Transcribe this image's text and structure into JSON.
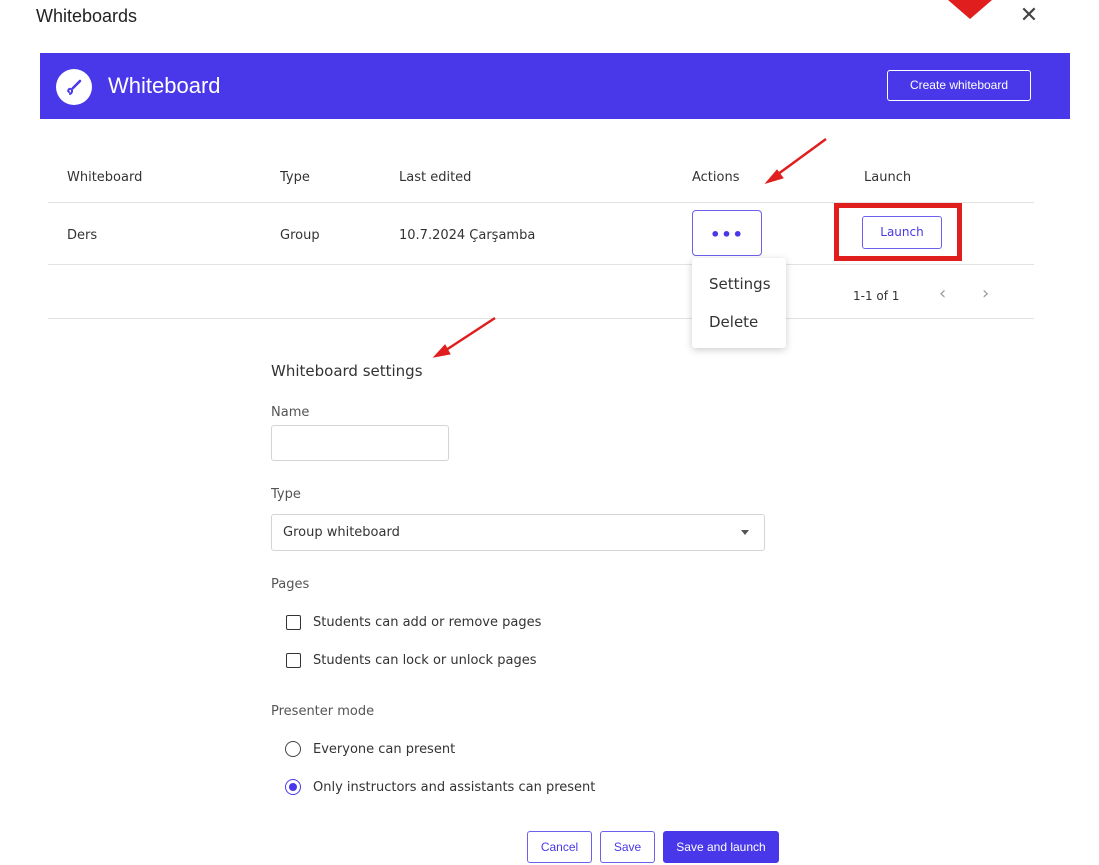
{
  "dialog": {
    "title": "Whiteboards",
    "close_glyph": "✕",
    "close_icon": "close-icon"
  },
  "banner": {
    "background_color": "#4938e9",
    "logo_icon": "whiteboard-brush-icon",
    "title": "Whiteboard",
    "create_button": "Create whiteboard"
  },
  "table": {
    "headers": [
      "Whiteboard",
      "Type",
      "Last edited",
      "Actions",
      "Launch"
    ],
    "rows": [
      {
        "name": "Ders",
        "type": "Group",
        "last_edited": "10.7.2024 Çarşamba",
        "actions_glyph": "•••",
        "launch": "Launch"
      }
    ]
  },
  "actions_menu": {
    "items": [
      "Settings",
      "Delete"
    ]
  },
  "pagination": {
    "text": "1-1 of 1",
    "prev_glyph": "‹",
    "next_glyph": "›"
  },
  "settings": {
    "title": "Whiteboard settings",
    "name_label": "Name",
    "name_value": "",
    "type_label": "Type",
    "type_value": "Group whiteboard",
    "pages_label": "Pages",
    "pages_options": [
      {
        "label": "Students can add or remove pages",
        "checked": false
      },
      {
        "label": "Students can lock or unlock pages",
        "checked": false
      }
    ],
    "presenter_label": "Presenter mode",
    "presenter_options": [
      {
        "label": "Everyone can present",
        "selected": false
      },
      {
        "label": "Only instructors and assistants can present",
        "selected": true
      }
    ]
  },
  "footer": {
    "cancel": "Cancel",
    "save": "Save",
    "save_launch": "Save and launch"
  },
  "annotations": {
    "arrow_color": "#e01e1e",
    "highlight_color": "#e01e1e"
  }
}
